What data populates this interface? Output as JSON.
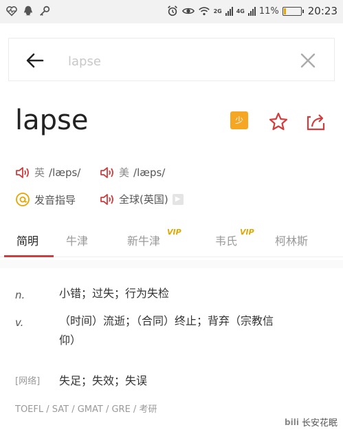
{
  "status_bar": {
    "left_icons": [
      "heart-monitor-icon",
      "qq-icon",
      "key-icon"
    ],
    "right_icons": [
      "alarm-icon",
      "eye-icon",
      "wifi-icon",
      "signal-icon",
      "battery-icon"
    ],
    "net_2g": "2G",
    "net_4g": "4G",
    "battery_percent": "11%",
    "battery_level": 0.11,
    "time": "20:23"
  },
  "search": {
    "placeholder": "lapse",
    "value": ""
  },
  "word": {
    "headword": "lapse",
    "badge_label": "少",
    "icons": [
      "notebook-badge-icon",
      "star-icon",
      "share-icon"
    ]
  },
  "pronunciation": {
    "uk_label": "英",
    "uk_ipa": "/læps/",
    "us_label": "美",
    "us_ipa": "/læps/",
    "guide_label": "发音指导",
    "global_label": "全球(英国)"
  },
  "tabs": [
    {
      "label": "简明",
      "vip": ""
    },
    {
      "label": "牛津",
      "vip": ""
    },
    {
      "label": "新牛津",
      "vip": "VIP"
    },
    {
      "label": "韦氏",
      "vip": "VIP"
    },
    {
      "label": "柯林斯",
      "vip": ""
    }
  ],
  "definitions": [
    {
      "pos": "n.",
      "text": "小错；过失；行为失检"
    },
    {
      "pos": "v.",
      "text_line1": "（时间）流逝；（合同）终止；背弃（宗教信",
      "text_line2": "仰）"
    }
  ],
  "web": {
    "tag": "[网络]",
    "text": "失足；失效；失误"
  },
  "exams": "TOEFL / SAT / GMAT / GRE / 考研",
  "watermark": "长安花眠",
  "colors": {
    "accent_red": "#d23c3c",
    "badge_orange": "#f5a623",
    "vip_gold": "#e0a800"
  }
}
